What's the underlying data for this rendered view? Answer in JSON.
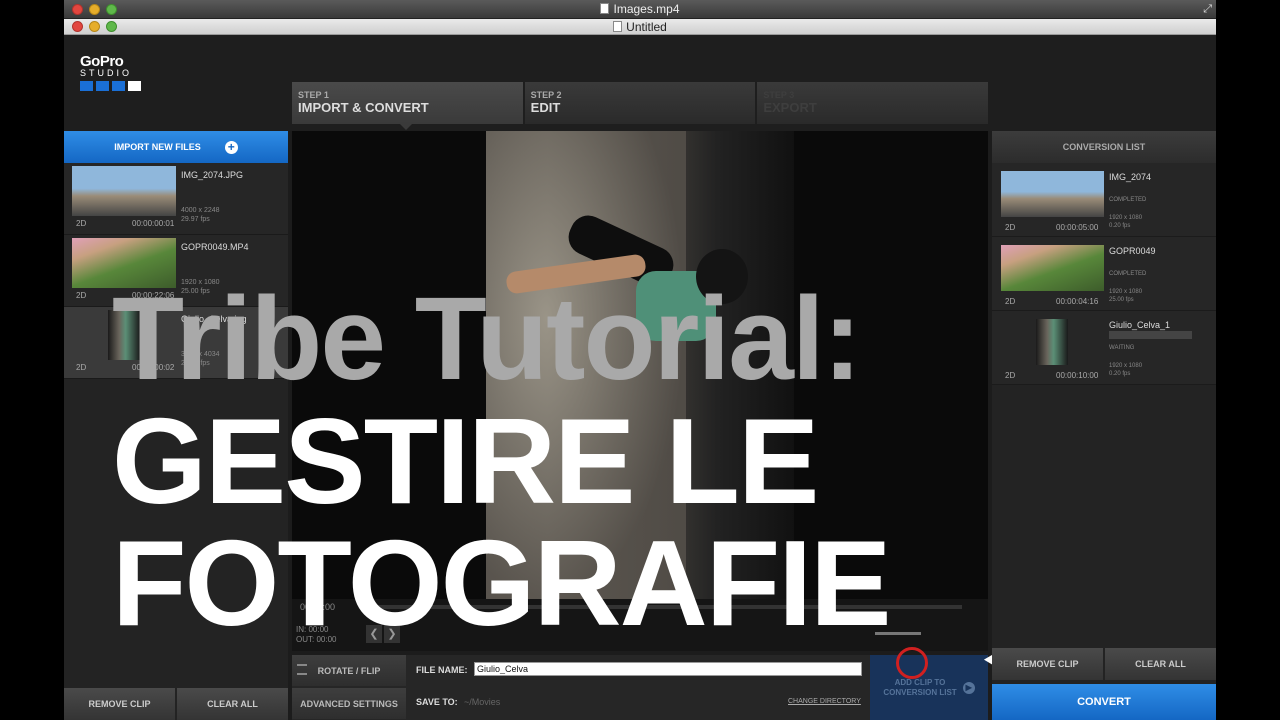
{
  "window": {
    "title": "Images.mp4",
    "document_title": "Untitled"
  },
  "logo": {
    "brand": "GoPro",
    "product": "STUDIO"
  },
  "steps": [
    {
      "number": "STEP 1",
      "label": "IMPORT & CONVERT",
      "state": "active"
    },
    {
      "number": "STEP 2",
      "label": "EDIT",
      "state": "inactive"
    },
    {
      "number": "STEP 3",
      "label": "EXPORT",
      "state": "disabled"
    }
  ],
  "left_panel": {
    "import_label": "IMPORT NEW FILES",
    "items": [
      {
        "name": "IMG_2074.JPG",
        "resolution": "4000 x 2248",
        "fps": "29.97 fps",
        "mode": "2D",
        "duration": "00:00:00:01"
      },
      {
        "name": "GOPR0049.MP4",
        "resolution": "1920 x 1080",
        "fps": "25.00 fps",
        "mode": "2D",
        "duration": "00:00:22:06"
      },
      {
        "name": "Giulio_Celva.jpg",
        "resolution": "3024 x 4034",
        "fps": "29.97 fps",
        "mode": "2D",
        "duration": "00:00:00:02"
      }
    ],
    "remove_clip": "REMOVE CLIP",
    "clear_all": "CLEAR ALL"
  },
  "preview": {
    "timecode": "00:00:00",
    "in_label": "IN: 00:00",
    "out_label": "OUT: 00:00"
  },
  "controls": {
    "rotate_flip": "ROTATE / FLIP",
    "advanced_settings": "ADVANCED SETTINGS",
    "file_name_label": "FILE NAME:",
    "file_name_value": "Giulio_Celva",
    "save_to_label": "SAVE TO:",
    "save_to_path": "~/Movies",
    "change_directory": "CHANGE DIRECTORY",
    "add_clip": "ADD CLIP TO\nCONVERSION LIST"
  },
  "right_panel": {
    "header": "CONVERSION LIST",
    "items": [
      {
        "name": "IMG_2074",
        "status": "COMPLETED",
        "resolution": "1920 x 1080",
        "fps": "0.20 fps",
        "mode": "2D",
        "duration": "00:00:05:00"
      },
      {
        "name": "GOPR0049",
        "status": "COMPLETED",
        "resolution": "1920 x 1080",
        "fps": "25.00 fps",
        "mode": "2D",
        "duration": "00:00:04:16"
      },
      {
        "name": "Giulio_Celva_1",
        "status": "WAITING",
        "resolution": "1920 x 1080",
        "fps": "0.20 fps",
        "mode": "2D",
        "duration": "00:00:10:00"
      }
    ],
    "remove_clip": "REMOVE CLIP",
    "clear_all": "CLEAR ALL",
    "convert": "CONVERT"
  },
  "overlay": {
    "line1": "Tribe Tutorial:",
    "line2": "GESTIRE LE",
    "line3": "FOTOGRAFIE"
  },
  "colors": {
    "accent_blue": "#1467c4",
    "click_ring": "#d02020"
  }
}
